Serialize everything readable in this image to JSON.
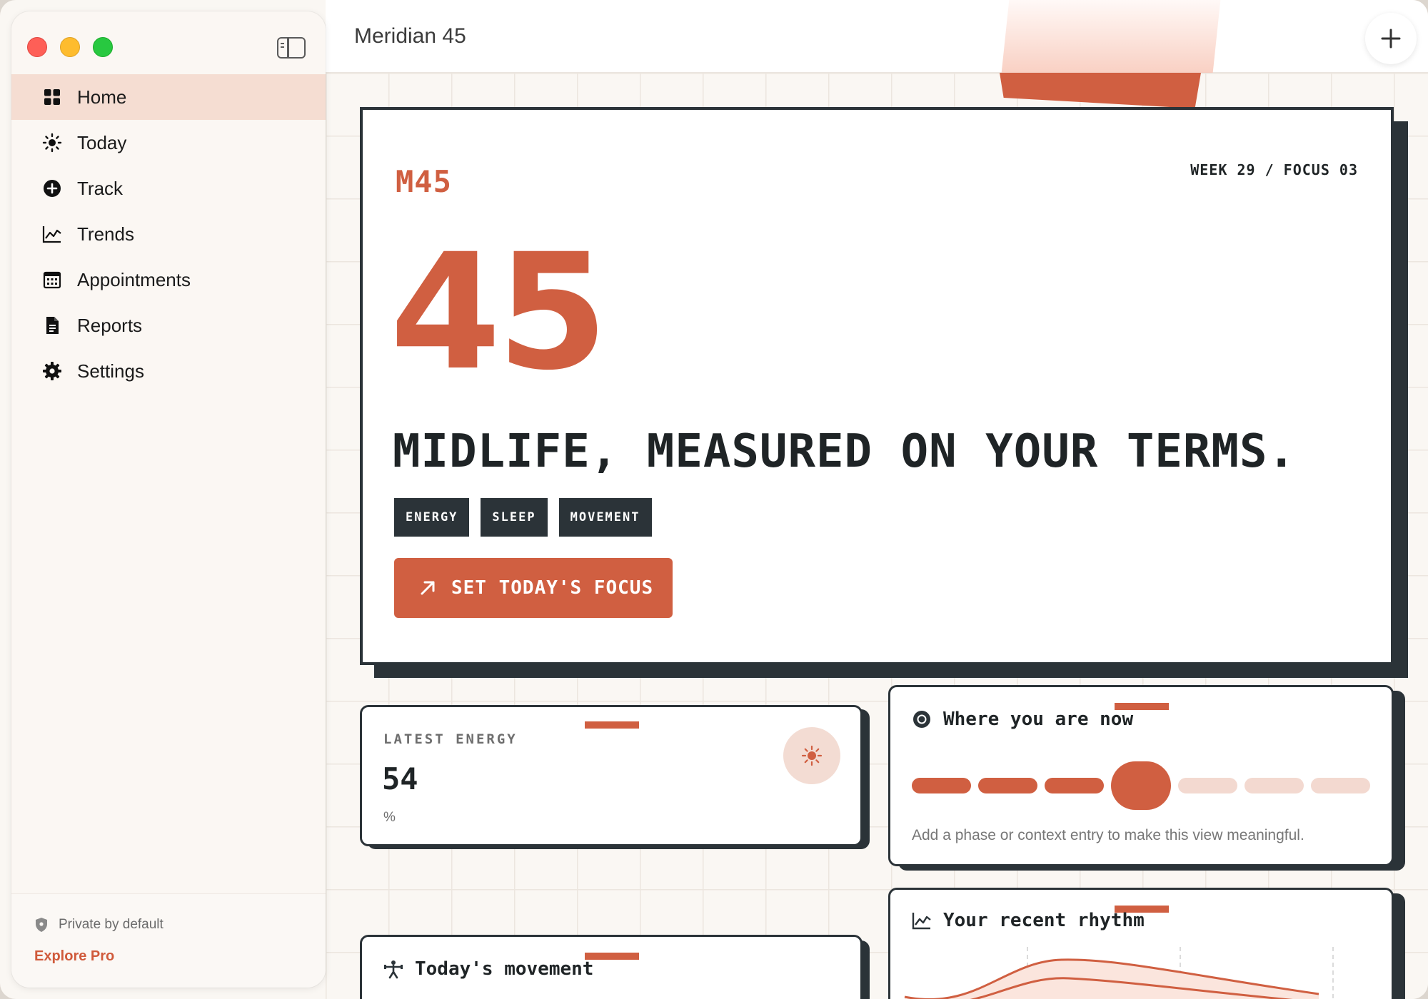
{
  "window": {
    "title": "Meridian 45"
  },
  "sidebar": {
    "items": [
      {
        "label": "Home",
        "icon": "grid-icon",
        "active": true
      },
      {
        "label": "Today",
        "icon": "sun-icon",
        "active": false
      },
      {
        "label": "Track",
        "icon": "plus-circle-icon",
        "active": false
      },
      {
        "label": "Trends",
        "icon": "line-chart-icon",
        "active": false
      },
      {
        "label": "Appointments",
        "icon": "calendar-icon",
        "active": false
      },
      {
        "label": "Reports",
        "icon": "document-icon",
        "active": false
      },
      {
        "label": "Settings",
        "icon": "gear-icon",
        "active": false
      }
    ],
    "footer": {
      "privacy_text": "Private by default",
      "explore_label": "Explore Pro"
    }
  },
  "hero": {
    "brand": "M45",
    "week_focus": "WEEK 29 / FOCUS 03",
    "big_number": "45",
    "tagline": "MIDLIFE, MEASURED ON YOUR TERMS.",
    "tags": [
      "ENERGY",
      "SLEEP",
      "MOVEMENT"
    ],
    "cta_label": "SET TODAY'S FOCUS"
  },
  "energy_card": {
    "label": "LATEST ENERGY",
    "value": "54",
    "unit": "%"
  },
  "phase_card": {
    "title": "Where you are now",
    "phases_total": 7,
    "current_phase_index": 3,
    "hint": "Add a phase or context entry to make this view meaningful."
  },
  "rhythm_card": {
    "title": "Your recent rhythm"
  },
  "movement_card": {
    "title": "Today's movement"
  },
  "colors": {
    "accent": "#d05f41",
    "ink": "#2b3338",
    "active_nav": "#f5ddd2",
    "pill_dim": "#f3d9d0"
  }
}
